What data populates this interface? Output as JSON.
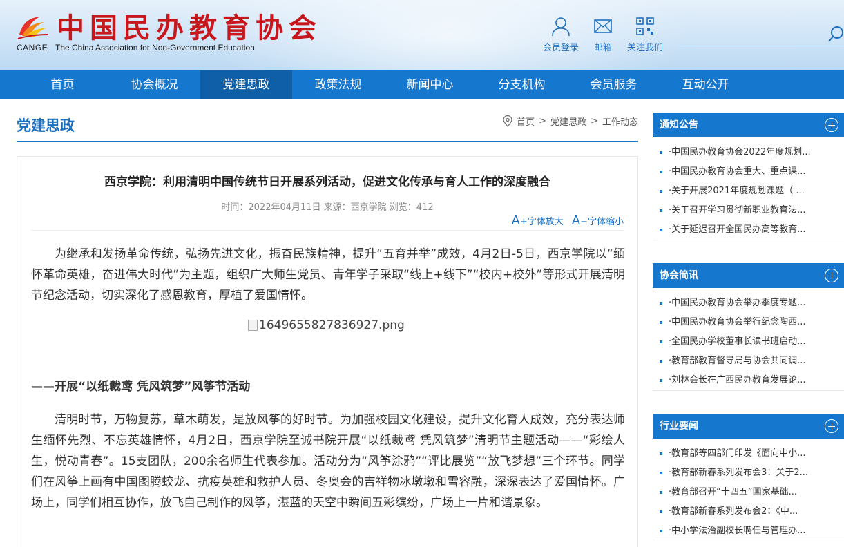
{
  "header": {
    "logo_cn": "中国民办教育协会",
    "logo_abbr": "CANGE",
    "logo_en": "The China Association for Non-Government Education",
    "links": [
      {
        "label": "会员登录",
        "icon": "user-icon"
      },
      {
        "label": "邮箱",
        "icon": "mail-icon"
      },
      {
        "label": "关注我们",
        "icon": "qrcode-icon"
      }
    ],
    "search_icon": "search-icon"
  },
  "nav": {
    "items": [
      "首页",
      "协会概况",
      "党建思政",
      "政策法规",
      "新闻中心",
      "分支机构",
      "会员服务",
      "互动公开"
    ],
    "active": "党建思政"
  },
  "section": {
    "title": "党建思政",
    "breadcrumb": [
      "首页",
      "党建思政",
      "工作动态"
    ],
    "breadcrumb_sep": ">"
  },
  "article": {
    "title": "西京学院：利用清明中国传统节日开展系列活动，促进文化传承与育人工作的深度融合",
    "meta": "时间：2022年04月11日 来源：西京学院 浏览：412",
    "font_larger": "+字体放大",
    "font_smaller": "−字体缩小",
    "font_icon_letter": "A",
    "para1": "为继承和发扬革命传统，弘扬先进文化，振奋民族精神，提升“五育并举”成效，4月2日-5日，西京学院以“缅怀革命英雄，奋进伟大时代”为主题，组织广大师生党员、青年学子采取“线上+线下”“校内+校外”等形式开展清明节纪念活动，切实深化了感恩教育，厚植了爱国情怀。",
    "image_alt": "1649655827836927.png",
    "subhead": "——开展“以纸裁鸢 凭风筑梦”风筝节活动",
    "para2": "清明时节，万物复苏，草木萌发，是放风筝的好时节。为加强校园文化建设，提升文化育人成效，充分表达师生缅怀先烈、不忘英雄情怀，4月2日，西京学院至诚书院开展“以纸裁鸢 凭风筑梦”清明节主题活动——“彩绘人生，悦动青春”。15支团队，200余名师生代表参加。活动分为“风筝涂鸦”“评比展览”“放飞梦想”三个环节。同学们在风筝上画有中国图腾蛟龙、抗疫英雄和救护人员、冬奥会的吉祥物冰墩墩和雪容融，深深表达了爱国情怀。广场上，同学们相互协作，放飞自己制作的风筝，湛蓝的天空中瞬间五彩缤纷，广场上一片和谐景象。"
  },
  "sidebar": {
    "boxes": [
      {
        "title": "通知公告",
        "items": [
          "·中国民办教育协会2022年度规划...",
          "·中国民办教育协会重大、重点课...",
          "·关于开展2021年度规划课题（ ...",
          "·关于召开学习贯彻新职业教育法...",
          "·关于延迟召开全国民办高等教育..."
        ]
      },
      {
        "title": "协会简讯",
        "items": [
          "·中国民办教育协会举办季度专题...",
          "·中国民办教育协会举行纪念陶西...",
          "·全国民办学校董事长读书班启动...",
          "·教育部教育督导局与协会共同调...",
          "·刘林会长在广西民办教育发展论..."
        ]
      },
      {
        "title": "行业要闻",
        "items": [
          "·教育部等四部门印发《面向中小...",
          "·教育部新春系列发布会3：关于2...",
          "·教育部召开“十四五”国家基础...",
          "·教育部新春系列发布会2：《中...",
          "·中小学法治副校长聘任与管理办..."
        ]
      }
    ]
  },
  "colors": {
    "brand_blue": "#1677cf",
    "nav_active": "#0e5fa8",
    "logo_red": "#c8161d",
    "title_blue": "#1a6fc0"
  }
}
